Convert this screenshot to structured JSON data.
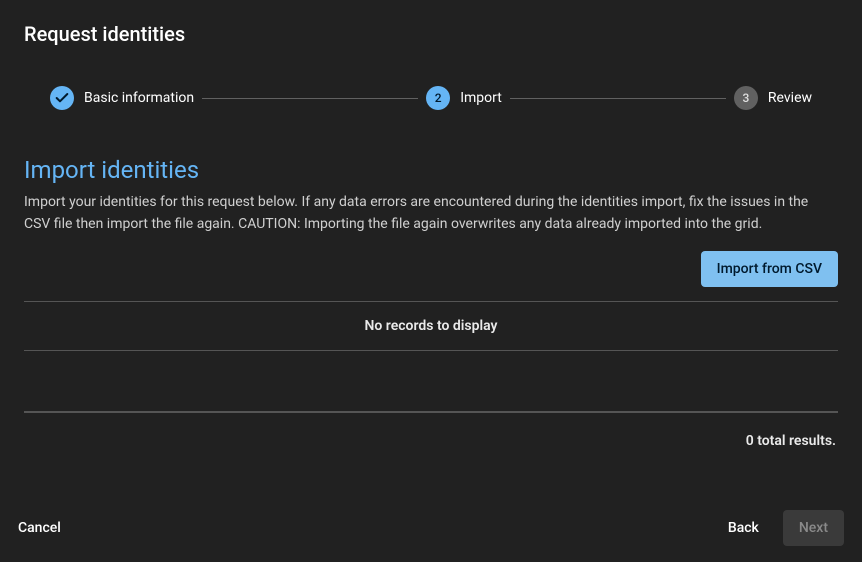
{
  "header": {
    "title": "Request identities"
  },
  "stepper": {
    "steps": [
      {
        "label": "Basic information"
      },
      {
        "label": "Import",
        "number": "2"
      },
      {
        "label": "Review",
        "number": "3"
      }
    ]
  },
  "section": {
    "title": "Import identities",
    "description": "Import your identities for this request below. If any data errors are encountered during the identities import, fix the issues in the CSV file then import the file again. CAUTION: Importing the file again overwrites any data already imported into the grid.",
    "import_button": "Import from CSV"
  },
  "grid": {
    "empty_message": "No records to display",
    "results_summary": "0 total results."
  },
  "footer": {
    "cancel": "Cancel",
    "back": "Back",
    "next": "Next"
  }
}
